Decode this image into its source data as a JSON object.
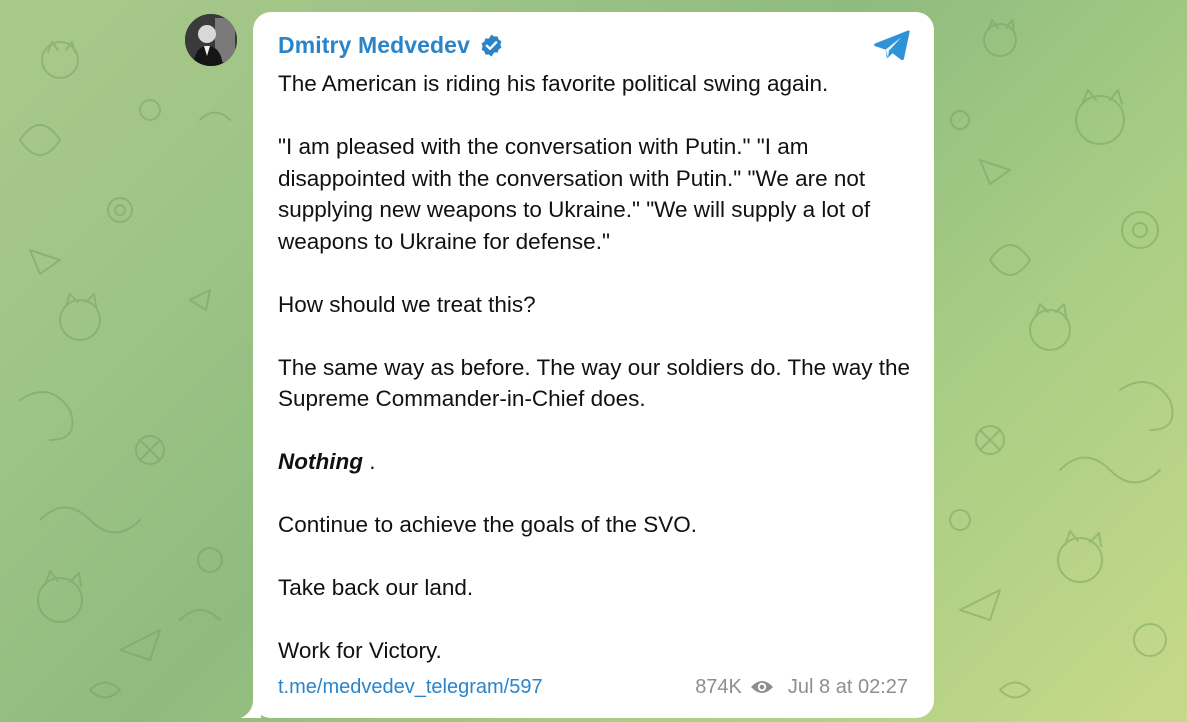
{
  "post": {
    "channel_name": "Dmitry Medvedev",
    "paragraphs": [
      "The American is riding his favorite political swing again.",
      "\"I am pleased with the conversation with Putin.\" \"I am disappointed with the conversation with Putin.\" \"We are not supplying new weapons to Ukraine.\" \"We will supply a lot of weapons to Ukraine for defense.\"",
      "How should we treat this?",
      "The same way as before. The way our soldiers do. The way the Supreme Commander-in-Chief does."
    ],
    "emphasis_word": "Nothing",
    "emphasis_suffix": " .",
    "closing_paragraphs": [
      "Continue to achieve the goals of the SVO.",
      "Take back our land.",
      "Work for Victory."
    ],
    "link": "t.me/medvedev_telegram/597",
    "views": "874K",
    "date": "Jul 8 at 02:27"
  },
  "icons": {
    "verified": "verified-badge-icon",
    "telegram": "telegram-logo-icon",
    "views": "eye-icon"
  },
  "colors": {
    "accent": "#2b84c8",
    "meta": "#8b8f93",
    "background": "#9fc487"
  }
}
